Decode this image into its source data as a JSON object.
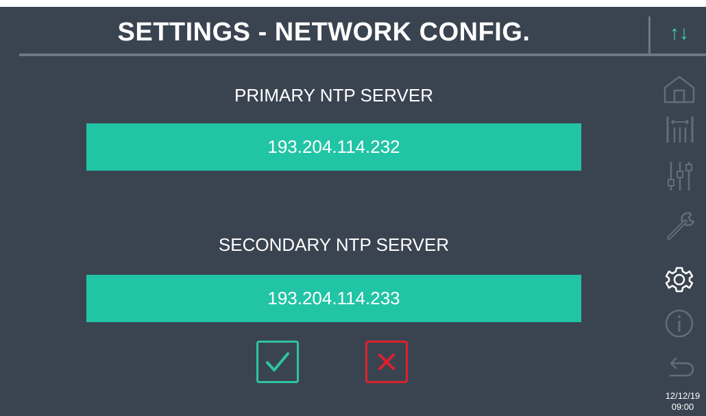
{
  "header": {
    "title": "SETTINGS - NETWORK CONFIG."
  },
  "fields": {
    "primary": {
      "label": "PRIMARY NTP SERVER",
      "value": "193.204.114.232"
    },
    "secondary": {
      "label": "SECONDARY NTP SERVER",
      "value": "193.204.114.233"
    }
  },
  "actions": {
    "confirm_icon": "check-icon",
    "cancel_icon": "close-icon"
  },
  "sidebar": {
    "scroll_icon": "up-down-arrows-icon",
    "items": [
      {
        "icon": "home-icon",
        "active": false
      },
      {
        "icon": "measurements-icon",
        "active": false
      },
      {
        "icon": "sliders-icon",
        "active": false
      },
      {
        "icon": "wrench-icon",
        "active": false
      },
      {
        "icon": "gear-icon",
        "active": true
      },
      {
        "icon": "info-icon",
        "active": false
      },
      {
        "icon": "back-arrow-icon",
        "active": false
      }
    ],
    "date": "12/12/19",
    "time": "09:00"
  },
  "colors": {
    "background": "#3a4451",
    "accent": "#22c4a6",
    "cancel": "#e0202b",
    "inactive_icon": "#626c7a"
  }
}
